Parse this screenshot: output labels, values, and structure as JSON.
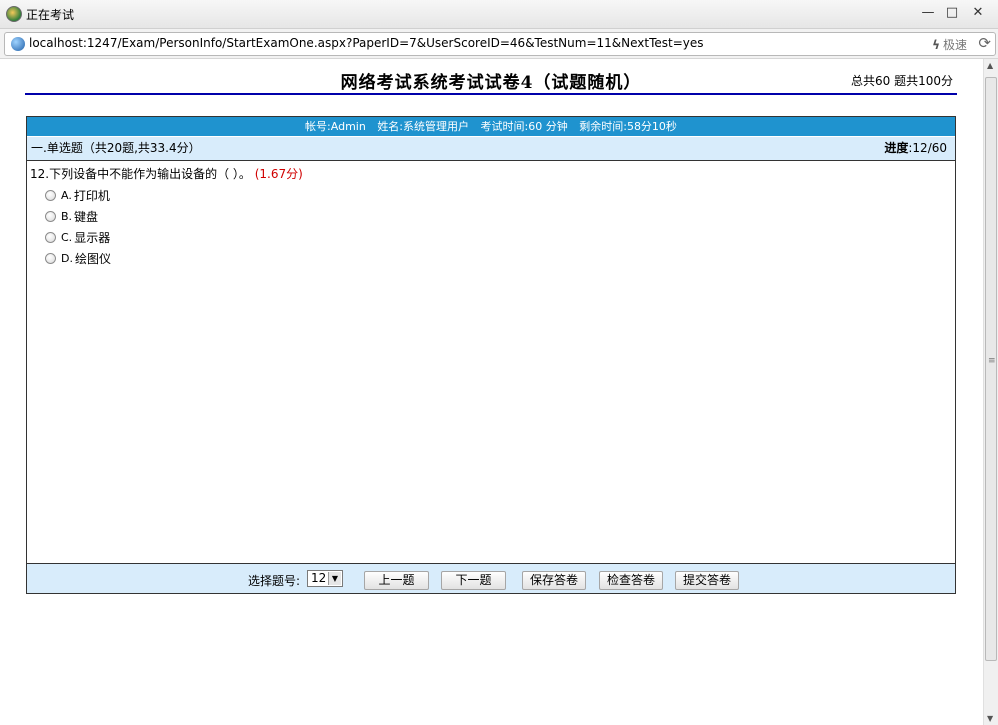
{
  "window": {
    "title": "正在考试",
    "minimize_label": "—",
    "maximize_label": "□",
    "close_label": "✕"
  },
  "addressbar": {
    "url": "localhost:1247/Exam/PersonInfo/StartExamOne.aspx?PaperID=7&UserScoreID=46&TestNum=11&NextTest=yes",
    "speed_label": "极速"
  },
  "exam": {
    "title": "网络考试系统考试试卷4（试题随机）",
    "total": "总共60 题共100分",
    "info": {
      "account": "帐号:Admin",
      "name": "姓名:系统管理用户",
      "duration": "考试时间:60 分钟",
      "remaining": "剩余时间:58分10秒"
    },
    "section_title": "一.单选题（共20题,共33.4分）",
    "progress_label": "进度",
    "progress_value": ":12/60",
    "question": {
      "text": "12.下列设备中不能作为输出设备的（ ）。",
      "score": "(1.67分)",
      "options": [
        {
          "letter": "A.",
          "text": "打印机"
        },
        {
          "letter": "B.",
          "text": "键盘"
        },
        {
          "letter": "C.",
          "text": "显示器"
        },
        {
          "letter": "D.",
          "text": "绘图仪"
        }
      ]
    }
  },
  "footer": {
    "select_label": "选择题号:",
    "selected_number": "12",
    "prev_button": "上一题",
    "next_button": "下一题",
    "save_button": "保存答卷",
    "check_button": "检查答卷",
    "submit_button": "提交答卷"
  },
  "colors": {
    "info_bar": "#1f93cf",
    "section_bg": "#d8ecfb",
    "title_rule": "#0000aa",
    "score_text": "#d00000"
  }
}
